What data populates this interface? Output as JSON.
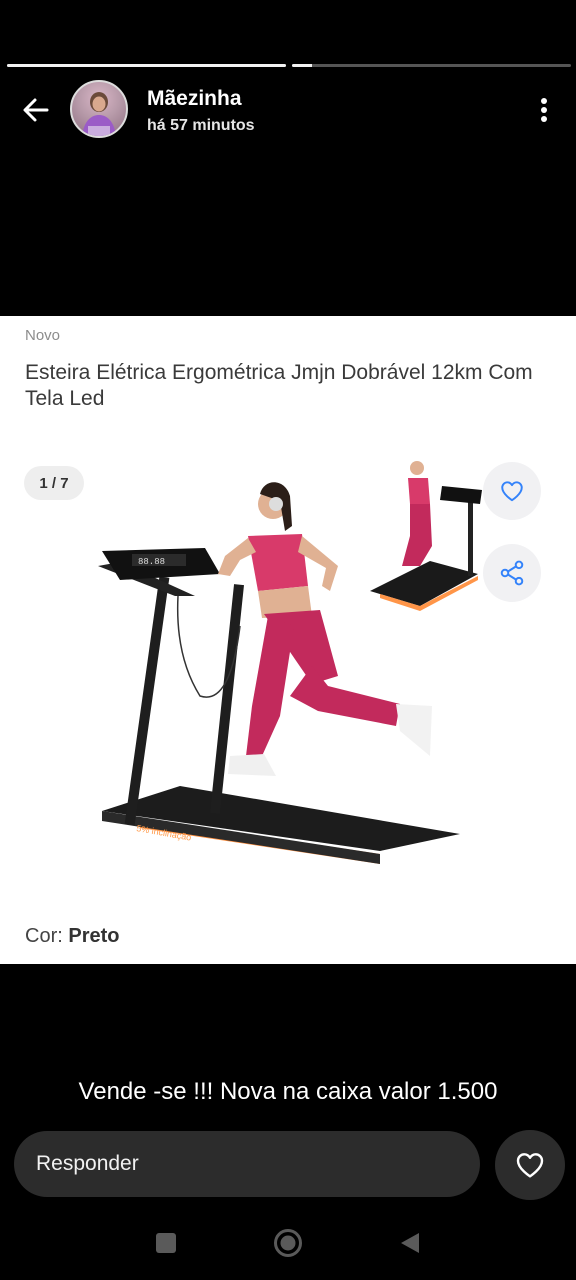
{
  "story": {
    "progress": [
      1.0,
      0.07
    ]
  },
  "header": {
    "user_name": "Mãezinha",
    "timestamp": "há 57 minutos",
    "back_icon": "arrow-left-icon",
    "menu_icon": "more-vertical-icon"
  },
  "product": {
    "condition": "Novo",
    "title": "Esteira Elétrica Ergométrica Jmjn Dobrável 12km Com Tela Led",
    "image_counter": "1 / 7",
    "variation_label": "Cor:",
    "variation_value": "Preto",
    "image_text": "5% inclinação",
    "favorite_icon": "heart-outline-icon",
    "share_icon": "share-icon",
    "accent_color": "#3483fa"
  },
  "caption": "Vende -se !!! Nova na caixa valor 1.500",
  "reply": {
    "placeholder": "Responder",
    "like_icon": "heart-outline-icon"
  },
  "system_nav": {
    "recent_icon": "square-icon",
    "home_icon": "circle-icon",
    "back_icon": "triangle-back-icon"
  }
}
